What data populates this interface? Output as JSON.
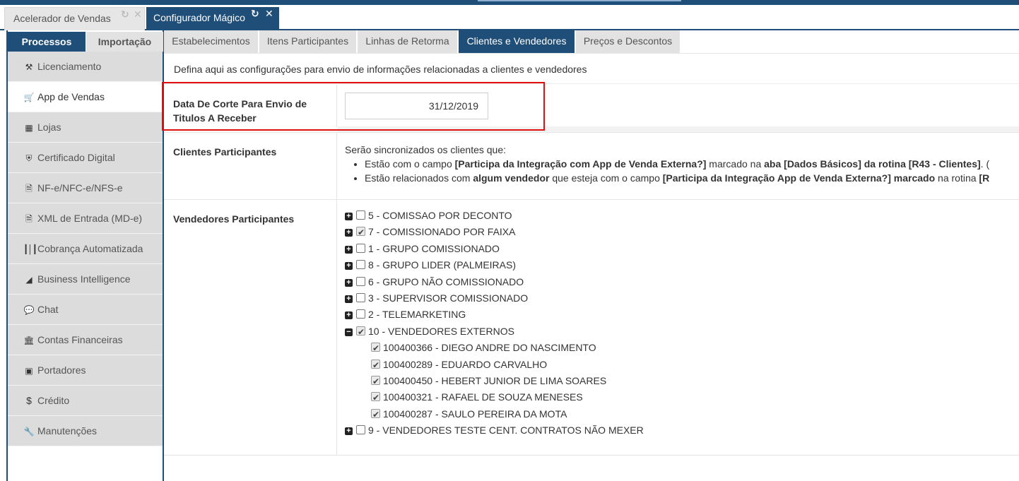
{
  "top_tabs": [
    {
      "label": "Acelerador de Vendas",
      "active": false
    },
    {
      "label": "Configurador Mágico",
      "active": true
    }
  ],
  "left_panel": {
    "tabs": [
      {
        "label": "Processos",
        "active": true
      },
      {
        "label": "Importação",
        "active": false
      }
    ],
    "menu": [
      {
        "label": "Licenciamento",
        "icon": "key-icon",
        "active": false
      },
      {
        "label": "App de Vendas",
        "icon": "cart-icon",
        "active": true
      },
      {
        "label": "Lojas",
        "icon": "building-icon",
        "active": false
      },
      {
        "label": "Certificado Digital",
        "icon": "shield-icon",
        "active": false
      },
      {
        "label": "NF-e/NFC-e/NFS-e",
        "icon": "document-icon",
        "active": false
      },
      {
        "label": "XML de Entrada (MD-e)",
        "icon": "file-icon",
        "active": false
      },
      {
        "label": "Cobrança Automatizada",
        "icon": "barcode-icon",
        "active": false
      },
      {
        "label": "Business Intelligence",
        "icon": "area-chart-icon",
        "active": false
      },
      {
        "label": "Chat",
        "icon": "chat-icon",
        "active": false
      },
      {
        "label": "Contas Financeiras",
        "icon": "bank-icon",
        "active": false
      },
      {
        "label": "Portadores",
        "icon": "money-icon",
        "active": false
      },
      {
        "label": "Crédito",
        "icon": "dollar-icon",
        "active": false
      },
      {
        "label": "Manutenções",
        "icon": "wrench-icon",
        "active": false
      }
    ]
  },
  "sub_tabs": [
    {
      "label": "Estabelecimentos",
      "active": false
    },
    {
      "label": "Itens Participantes",
      "active": false
    },
    {
      "label": "Linhas de Retorma",
      "active": false
    },
    {
      "label": "Clientes e Vendedores",
      "active": true
    },
    {
      "label": "Preços e Descontos",
      "active": false
    }
  ],
  "description": "Defina aqui as configurações para envio de informações relacionadas a clientes e vendedores",
  "cutoff": {
    "label_line1": "Data De Corte Para Envio de",
    "label_line2": "Titulos A Receber",
    "value": "31/12/2019"
  },
  "clients": {
    "label": "Clientes Participantes",
    "intro": "Serão sincronizados os clientes que:",
    "bullet1": {
      "t1": "Estão com o campo ",
      "b1": "[Participa da Integração com App de Venda Externa?]",
      "t2": " marcado na ",
      "b2": "aba [Dados Básicos] da rotina [R43 - Clientes]",
      "t3": ". ("
    },
    "bullet2": {
      "t1": "Estão relacionados com ",
      "b1": "algum vendedor",
      "t2": " que esteja com o campo ",
      "b2": "[Participa da Integração App de Venda Externa?] marcado",
      "t3": " na rotina ",
      "b3": "[R"
    }
  },
  "sellers": {
    "label": "Vendedores Participantes",
    "groups": [
      {
        "label": "5 - COMISSAO POR DECONTO",
        "checked": false,
        "expanded": false
      },
      {
        "label": "7 - COMISSIONADO POR FAIXA",
        "checked": true,
        "expanded": false
      },
      {
        "label": "1 - GRUPO COMISSIONADO",
        "checked": false,
        "expanded": false
      },
      {
        "label": "8 - GRUPO LIDER (PALMEIRAS)",
        "checked": false,
        "expanded": false
      },
      {
        "label": "6 - GRUPO NÃO COMISSIONADO",
        "checked": false,
        "expanded": false
      },
      {
        "label": "3 - SUPERVISOR COMISSIONADO",
        "checked": false,
        "expanded": false
      },
      {
        "label": "2 - TELEMARKETING",
        "checked": false,
        "expanded": false
      },
      {
        "label": "10 - VENDEDORES EXTERNOS",
        "checked": true,
        "expanded": true,
        "children": [
          {
            "label": "100400366 - DIEGO ANDRE DO NASCIMENTO",
            "checked": true
          },
          {
            "label": "100400289 - EDUARDO CARVALHO",
            "checked": true
          },
          {
            "label": "100400450 - HEBERT JUNIOR DE LIMA SOARES",
            "checked": true
          },
          {
            "label": "100400321 - RAFAEL DE SOUZA MENESES",
            "checked": true
          },
          {
            "label": "100400287 - SAULO PEREIRA DA MOTA",
            "checked": true
          }
        ]
      },
      {
        "label": "9 - VENDEDORES TESTE CENT. CONTRATOS NÃO MEXER",
        "checked": false,
        "expanded": false
      }
    ]
  },
  "colors": {
    "primary": "#1f4e79",
    "highlight_border": "#e01010"
  }
}
